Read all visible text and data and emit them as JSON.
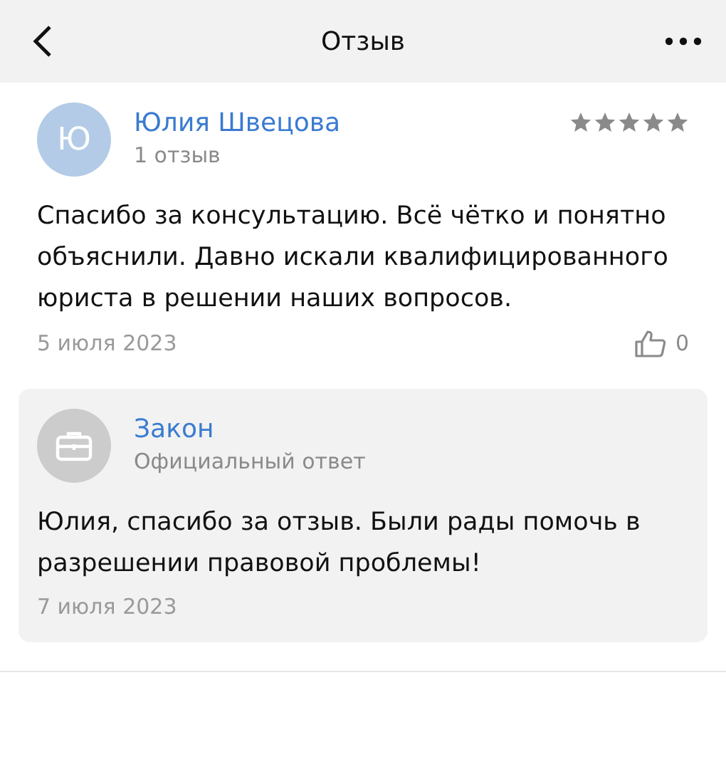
{
  "header": {
    "title": "Отзыв"
  },
  "review": {
    "avatar_letter": "Ю",
    "author": "Юлия Швецова",
    "reviews_count": "1 отзыв",
    "stars": 5,
    "text": "Спасибо за консультацию. Всё чётко и понятно объяснили. Давно искали квалифицированного юриста в решении наших вопросов.",
    "date": "5 июля 2023",
    "likes": "0",
    "liked": false
  },
  "reply": {
    "author": "Закон",
    "role": "Официальный ответ",
    "text": "Юлия, спасибо за отзыв. Были рады помочь в разрешении правовой проблемы!",
    "date": "7 июля 2023"
  }
}
